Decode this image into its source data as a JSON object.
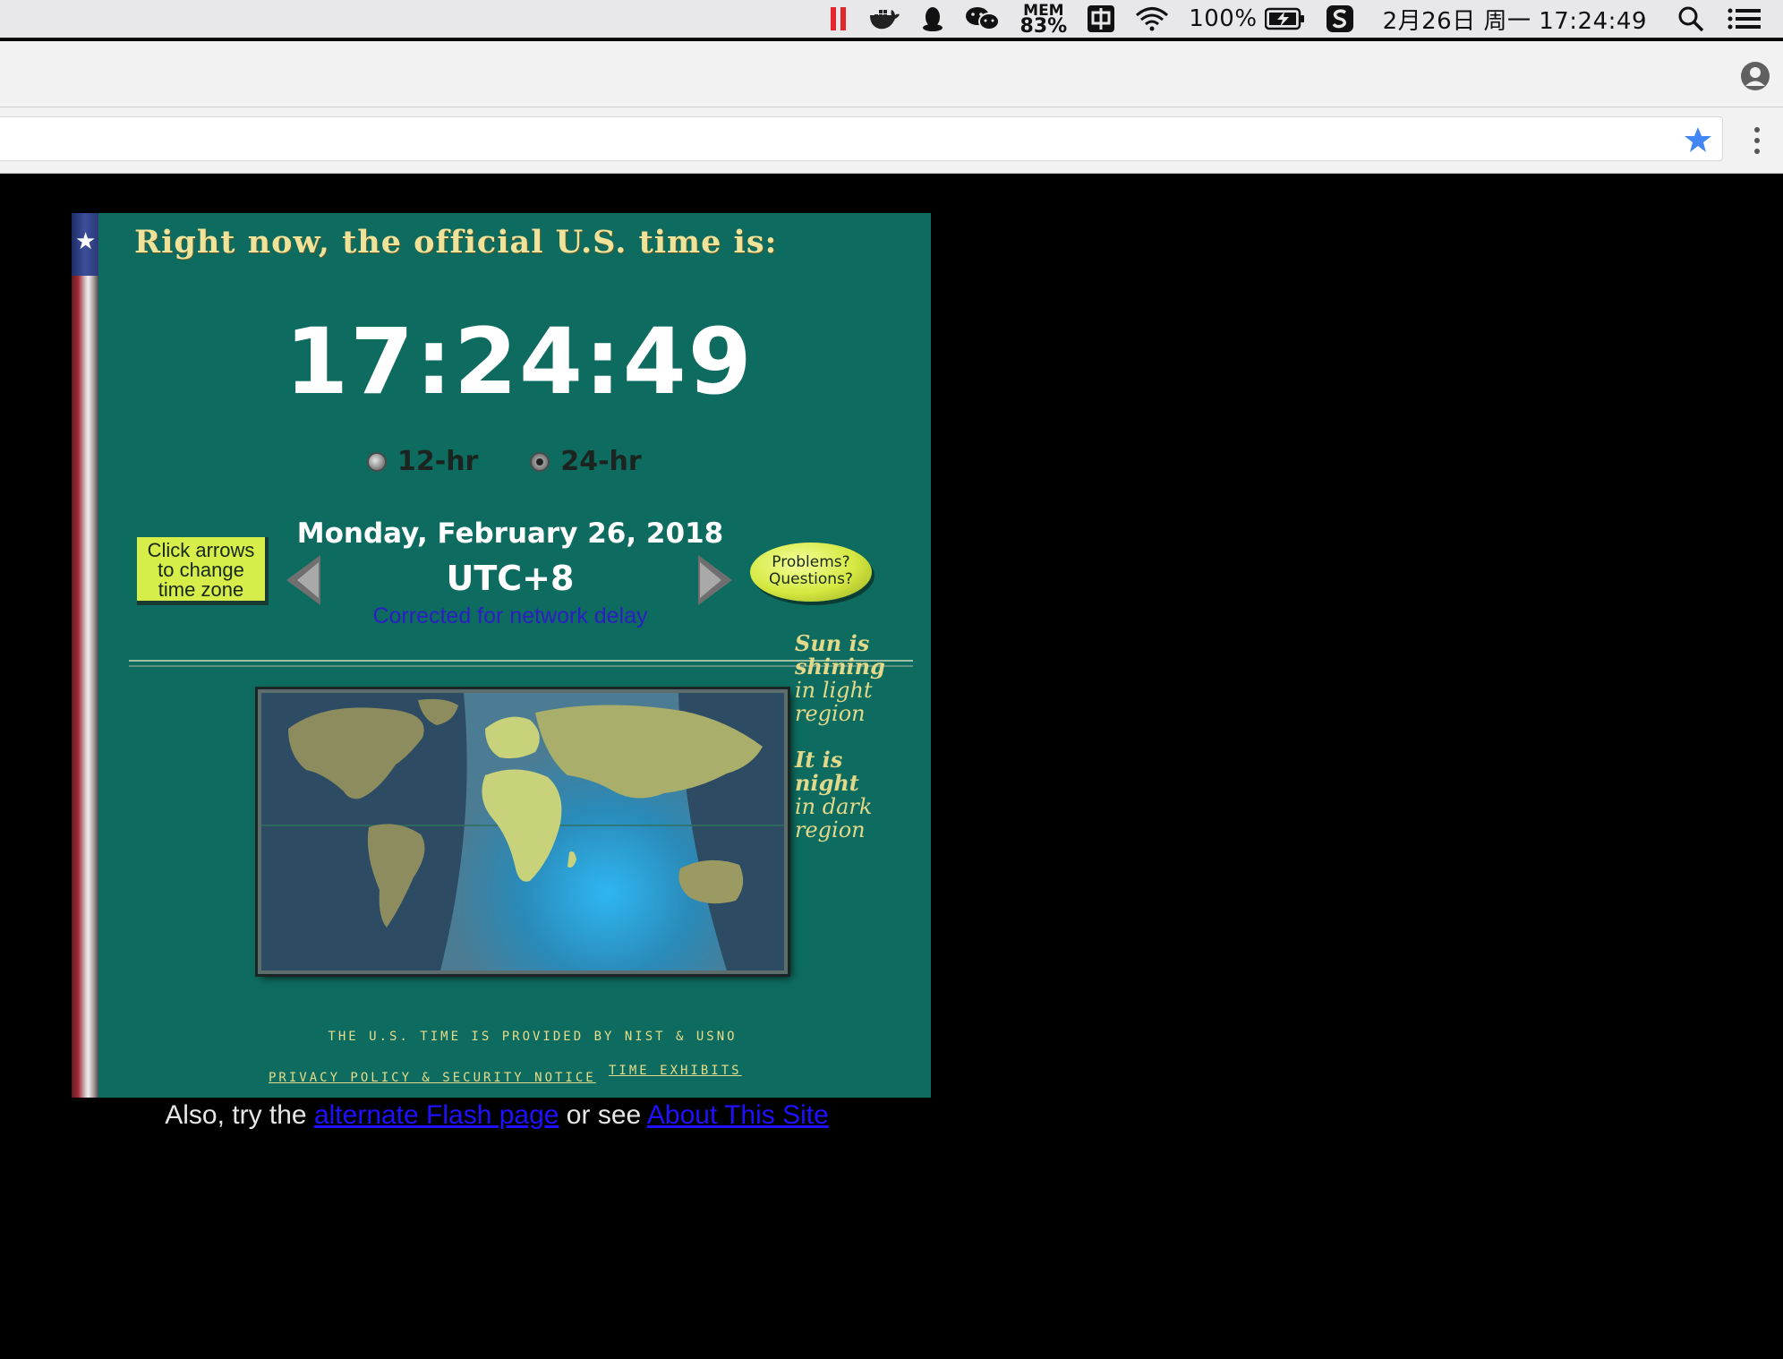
{
  "menubar": {
    "mem_label": "MEM",
    "mem_value": "83%",
    "battery_text": "100%",
    "datetime": "2月26日 周一  17:24:49"
  },
  "page": {
    "headline": "Right now, the official U.S. time is:",
    "clock": "17:24:49",
    "radio_12": "12-hr",
    "radio_24": "24-hr",
    "radio_selected": "24-hr",
    "click_arrows_line1": "Click arrows",
    "click_arrows_line2": "to change",
    "click_arrows_line3": "time zone",
    "date": "Monday, February 26, 2018",
    "timezone": "UTC+8",
    "network_delay": "Corrected for network delay",
    "problems_line1": "Problems?",
    "problems_line2": "Questions?",
    "legend_day_bold1": "Sun is",
    "legend_day_bold2": "shining",
    "legend_day_1": "in light",
    "legend_day_2": "region",
    "legend_night_bold1": "It is",
    "legend_night_bold2": "night",
    "legend_night_1": "in dark",
    "legend_night_2": "region",
    "provided": "THE U.S. TIME IS PROVIDED BY NIST & USNO",
    "privacy": "PRIVACY POLICY & SECURITY NOTICE",
    "exhibits": "TIME EXHIBITS"
  },
  "footer": {
    "text1": "Also, try the ",
    "link1": "alternate Flash page",
    "text2": " or see ",
    "link2": "About This Site"
  },
  "colors": {
    "panel": "#0e6b5f",
    "headline": "#efe39a",
    "link": "#1f10ff",
    "network_delay": "#2b1ec2"
  }
}
